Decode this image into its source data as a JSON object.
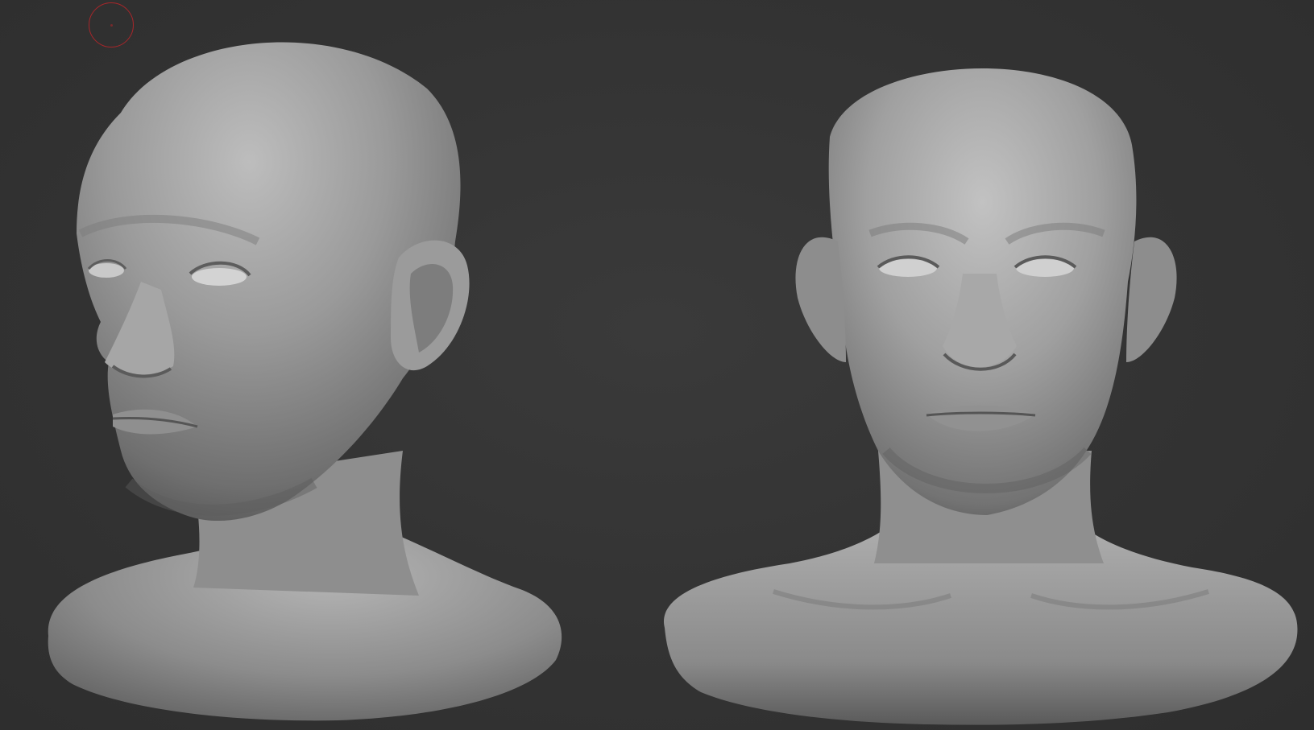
{
  "app": {
    "view": "sculpt-viewport",
    "background_color": "#333333",
    "brush_cursor_color": "#a8262a"
  },
  "models": [
    {
      "id": "head-three-quarter",
      "view": "three-quarter",
      "icon": "head-sculpt-icon"
    },
    {
      "id": "head-front",
      "view": "front",
      "icon": "head-sculpt-icon"
    }
  ]
}
